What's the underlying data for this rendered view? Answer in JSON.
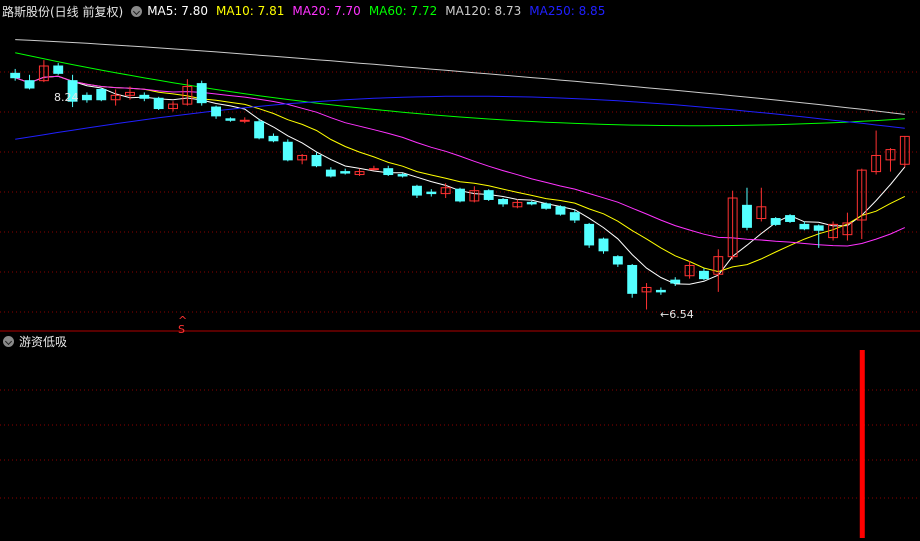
{
  "header": {
    "title": "路斯股份(日线 前复权)",
    "ma": [
      {
        "label": "MA5: 7.80",
        "color": "#ffffff"
      },
      {
        "label": "MA10: 7.81",
        "color": "#ffff00"
      },
      {
        "label": "MA20: 7.70",
        "color": "#ff33ff"
      },
      {
        "label": "MA60: 7.72",
        "color": "#00ff00"
      },
      {
        "label": "MA120: 8.73",
        "color": "#cccccc"
      },
      {
        "label": "MA250: 8.85",
        "color": "#2020ff"
      }
    ]
  },
  "indicator": {
    "title": "游资低吸"
  },
  "annotations": {
    "high_label": "8.24",
    "low_label": "6.54",
    "signal_mark": "S"
  },
  "colors": {
    "up": "#ff3232",
    "down": "#54ffff",
    "grid": "#8b0000",
    "bg": "#000000",
    "signal": "#ff0000"
  },
  "chart_data": {
    "type": "candlestick",
    "ylim": [
      6.4,
      8.5
    ],
    "high": 8.24,
    "low": 6.54,
    "candles": [
      {
        "o": 8.15,
        "h": 8.18,
        "l": 8.1,
        "c": 8.12
      },
      {
        "o": 8.1,
        "h": 8.14,
        "l": 8.04,
        "c": 8.05
      },
      {
        "o": 8.1,
        "h": 8.24,
        "l": 8.09,
        "c": 8.2
      },
      {
        "o": 8.2,
        "h": 8.22,
        "l": 8.14,
        "c": 8.15
      },
      {
        "o": 8.1,
        "h": 8.14,
        "l": 7.92,
        "c": 7.96
      },
      {
        "o": 8.0,
        "h": 8.02,
        "l": 7.95,
        "c": 7.97
      },
      {
        "o": 8.04,
        "h": 8.05,
        "l": 7.96,
        "c": 7.97
      },
      {
        "o": 7.97,
        "h": 8.04,
        "l": 7.93,
        "c": 8.0
      },
      {
        "o": 8.0,
        "h": 8.06,
        "l": 7.97,
        "c": 8.02
      },
      {
        "o": 8.0,
        "h": 8.02,
        "l": 7.96,
        "c": 7.98
      },
      {
        "o": 7.98,
        "h": 7.99,
        "l": 7.9,
        "c": 7.91
      },
      {
        "o": 7.91,
        "h": 7.96,
        "l": 7.89,
        "c": 7.94
      },
      {
        "o": 7.94,
        "h": 8.11,
        "l": 7.93,
        "c": 8.06
      },
      {
        "o": 8.08,
        "h": 8.1,
        "l": 7.93,
        "c": 7.95
      },
      {
        "o": 7.92,
        "h": 7.93,
        "l": 7.84,
        "c": 7.86
      },
      {
        "o": 7.84,
        "h": 7.85,
        "l": 7.82,
        "c": 7.83
      },
      {
        "o": 7.83,
        "h": 7.85,
        "l": 7.81,
        "c": 7.83
      },
      {
        "o": 7.82,
        "h": 7.84,
        "l": 7.7,
        "c": 7.71
      },
      {
        "o": 7.72,
        "h": 7.74,
        "l": 7.68,
        "c": 7.69
      },
      {
        "o": 7.68,
        "h": 7.7,
        "l": 7.55,
        "c": 7.56
      },
      {
        "o": 7.56,
        "h": 7.6,
        "l": 7.53,
        "c": 7.59
      },
      {
        "o": 7.59,
        "h": 7.61,
        "l": 7.51,
        "c": 7.52
      },
      {
        "o": 7.49,
        "h": 7.51,
        "l": 7.44,
        "c": 7.45
      },
      {
        "o": 7.48,
        "h": 7.5,
        "l": 7.46,
        "c": 7.47
      },
      {
        "o": 7.46,
        "h": 7.5,
        "l": 7.45,
        "c": 7.48
      },
      {
        "o": 7.5,
        "h": 7.52,
        "l": 7.49,
        "c": 7.5
      },
      {
        "o": 7.5,
        "h": 7.52,
        "l": 7.45,
        "c": 7.46
      },
      {
        "o": 7.46,
        "h": 7.47,
        "l": 7.44,
        "c": 7.45
      },
      {
        "o": 7.38,
        "h": 7.39,
        "l": 7.3,
        "c": 7.32
      },
      {
        "o": 7.34,
        "h": 7.36,
        "l": 7.31,
        "c": 7.33
      },
      {
        "o": 7.33,
        "h": 7.4,
        "l": 7.3,
        "c": 7.37
      },
      {
        "o": 7.36,
        "h": 7.37,
        "l": 7.27,
        "c": 7.28
      },
      {
        "o": 7.28,
        "h": 7.38,
        "l": 7.27,
        "c": 7.35
      },
      {
        "o": 7.35,
        "h": 7.36,
        "l": 7.28,
        "c": 7.29
      },
      {
        "o": 7.29,
        "h": 7.3,
        "l": 7.24,
        "c": 7.26
      },
      {
        "o": 7.24,
        "h": 7.29,
        "l": 7.23,
        "c": 7.27
      },
      {
        "o": 7.27,
        "h": 7.28,
        "l": 7.25,
        "c": 7.26
      },
      {
        "o": 7.26,
        "h": 7.27,
        "l": 7.22,
        "c": 7.23
      },
      {
        "o": 7.24,
        "h": 7.25,
        "l": 7.18,
        "c": 7.19
      },
      {
        "o": 7.2,
        "h": 7.22,
        "l": 7.13,
        "c": 7.15
      },
      {
        "o": 7.12,
        "h": 7.13,
        "l": 6.96,
        "c": 6.98
      },
      {
        "o": 7.02,
        "h": 7.03,
        "l": 6.92,
        "c": 6.94
      },
      {
        "o": 6.9,
        "h": 6.91,
        "l": 6.83,
        "c": 6.85
      },
      {
        "o": 6.84,
        "h": 6.85,
        "l": 6.62,
        "c": 6.65
      },
      {
        "o": 6.66,
        "h": 6.72,
        "l": 6.54,
        "c": 6.69
      },
      {
        "o": 6.67,
        "h": 6.69,
        "l": 6.64,
        "c": 6.66
      },
      {
        "o": 6.74,
        "h": 6.76,
        "l": 6.7,
        "c": 6.72
      },
      {
        "o": 6.77,
        "h": 6.87,
        "l": 6.75,
        "c": 6.84
      },
      {
        "o": 6.8,
        "h": 6.82,
        "l": 6.74,
        "c": 6.75
      },
      {
        "o": 6.78,
        "h": 6.95,
        "l": 6.66,
        "c": 6.9
      },
      {
        "o": 6.9,
        "h": 7.35,
        "l": 6.88,
        "c": 7.3
      },
      {
        "o": 7.25,
        "h": 7.37,
        "l": 7.08,
        "c": 7.1
      },
      {
        "o": 7.16,
        "h": 7.37,
        "l": 7.14,
        "c": 7.24
      },
      {
        "o": 7.16,
        "h": 7.17,
        "l": 7.11,
        "c": 7.12
      },
      {
        "o": 7.18,
        "h": 7.19,
        "l": 7.13,
        "c": 7.14
      },
      {
        "o": 7.12,
        "h": 7.14,
        "l": 7.08,
        "c": 7.09
      },
      {
        "o": 7.11,
        "h": 7.12,
        "l": 6.96,
        "c": 7.08
      },
      {
        "o": 7.03,
        "h": 7.14,
        "l": 7.01,
        "c": 7.12
      },
      {
        "o": 7.05,
        "h": 7.2,
        "l": 7.01,
        "c": 7.13
      },
      {
        "o": 7.15,
        "h": 7.5,
        "l": 7.02,
        "c": 7.49
      },
      {
        "o": 7.48,
        "h": 7.76,
        "l": 7.46,
        "c": 7.59
      },
      {
        "o": 7.56,
        "h": 7.64,
        "l": 7.48,
        "c": 7.63
      },
      {
        "o": 7.53,
        "h": 7.72,
        "l": 7.51,
        "c": 7.72
      }
    ],
    "signal_index": 59,
    "signal_value": 1
  }
}
